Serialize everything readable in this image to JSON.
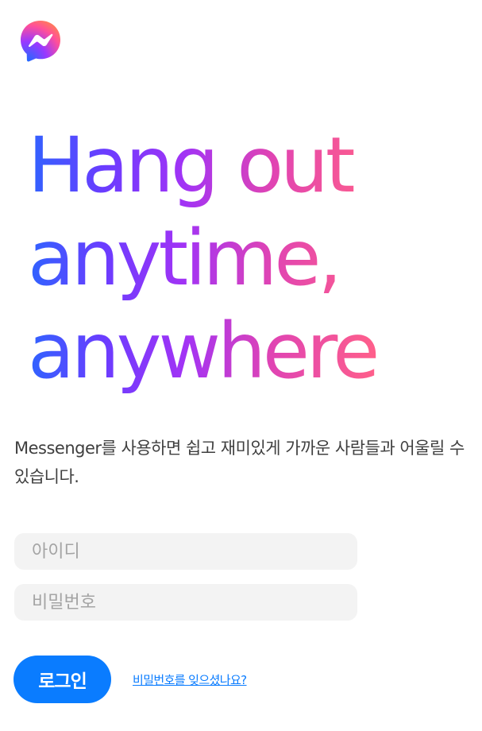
{
  "logo": {
    "icon": "messenger-logo-icon",
    "gradient_colors": [
      "#2f63ff",
      "#a234f5",
      "#ff5f8a"
    ]
  },
  "hero": {
    "lines": [
      "Hang out",
      "anytime,",
      "anywhere"
    ],
    "gradient_colors": [
      "#2f63ff",
      "#a233f5",
      "#ff5f8a"
    ]
  },
  "tagline": "Messenger를 사용하면 쉽고 재미있게 가까운 사람들과 어울릴 수 있습니다.",
  "form": {
    "id_placeholder": "아이디",
    "password_placeholder": "비밀번호",
    "login_label": "로그인",
    "forgot_label": "비밀번호를 잊으셨나요?"
  },
  "colors": {
    "accent": "#0a7cff",
    "input_background": "#f3f3f3",
    "text": "#3f3f3f"
  }
}
